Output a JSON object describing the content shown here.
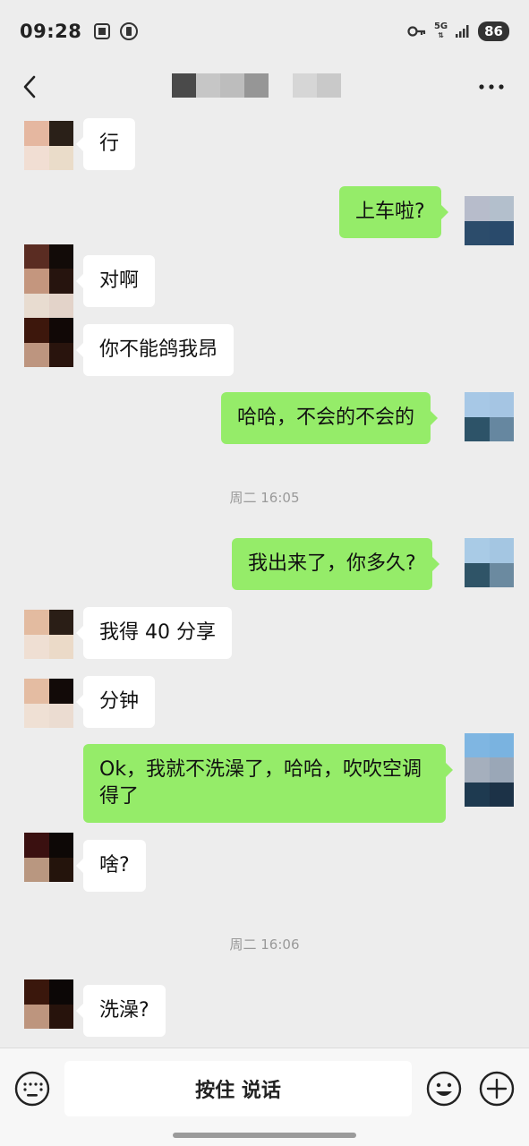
{
  "status_bar": {
    "time": "09:28",
    "network": "5G",
    "battery": "86",
    "icons": [
      "screenshot-icon",
      "battery-saver-icon",
      "key-icon",
      "signal-icon"
    ]
  },
  "header": {
    "back_icon": "chevron-left-icon",
    "title_blurred": true,
    "more_icon": "more-dots-icon"
  },
  "messages": [
    {
      "side": "in",
      "text": "行"
    },
    {
      "side": "out",
      "text": "上车啦?"
    },
    {
      "side": "in",
      "text": "对啊"
    },
    {
      "side": "in",
      "text": "你不能鸽我昂"
    },
    {
      "side": "out",
      "text": "哈哈，不会的不会的"
    },
    {
      "type": "time",
      "text": "周二 16:05"
    },
    {
      "side": "out",
      "text": "我出来了，你多久?"
    },
    {
      "side": "in",
      "text": "我得 40 分享"
    },
    {
      "side": "in",
      "text": "分钟"
    },
    {
      "side": "out",
      "text": "Ok，我就不洗澡了，哈哈，吹吹空调得了"
    },
    {
      "side": "in",
      "text": "啥?"
    },
    {
      "type": "time",
      "text": "周二 16:06"
    },
    {
      "side": "in",
      "text": "洗澡?"
    }
  ],
  "input_bar": {
    "hold_to_talk": "按住 说话",
    "left_icon": "keyboard-icon",
    "emoji_icon": "emoji-icon",
    "plus_icon": "plus-circle-icon"
  },
  "colors": {
    "background": "#ededed",
    "outgoing_bubble": "#95ec69",
    "incoming_bubble": "#ffffff"
  }
}
